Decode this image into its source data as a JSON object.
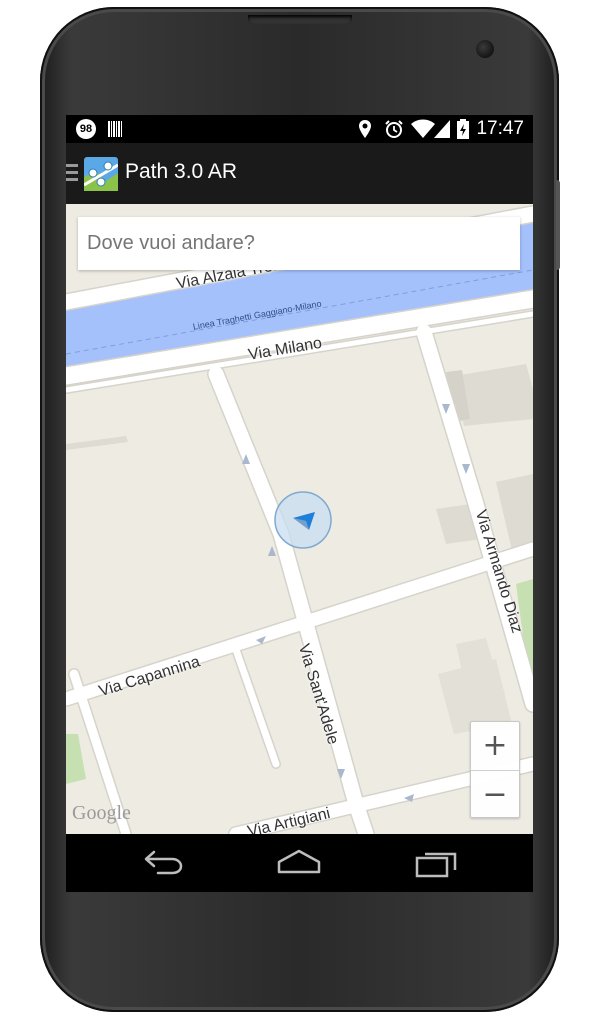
{
  "status_bar": {
    "notification_count": "98",
    "time": "17:47",
    "icons": [
      "barcode-icon",
      "location-pin-icon",
      "alarm-icon",
      "wifi-icon",
      "signal-icon",
      "battery-icon"
    ]
  },
  "action_bar": {
    "title": "Path 3.0 AR",
    "icons": [
      "drawer-icon",
      "app-logo-icon"
    ]
  },
  "map": {
    "search_placeholder": "Dove vuoi andare?",
    "streets": {
      "alzaia": "Via Alzaia Trento",
      "ferry": "Linea Traghetti Gaggiano-Milano",
      "milano": "Via Milano",
      "armando_diaz": "Via Armando Diaz",
      "capannina": "Via Capannina",
      "sant_adele": "Via Sant'Adele",
      "artigiani": "Via Artigiani"
    },
    "zoom_in_label": "+",
    "zoom_out_label": "−",
    "attribution": "Google",
    "colors": {
      "land": "#eeebe3",
      "water": "#a4c1fb",
      "road": "#ffffff",
      "park": "#c7e0b2",
      "building": "#dedbd3",
      "location_marker": "#1e7fd9"
    }
  },
  "nav_bar": {
    "icons": [
      "back-icon",
      "home-icon",
      "recent-apps-icon"
    ]
  }
}
